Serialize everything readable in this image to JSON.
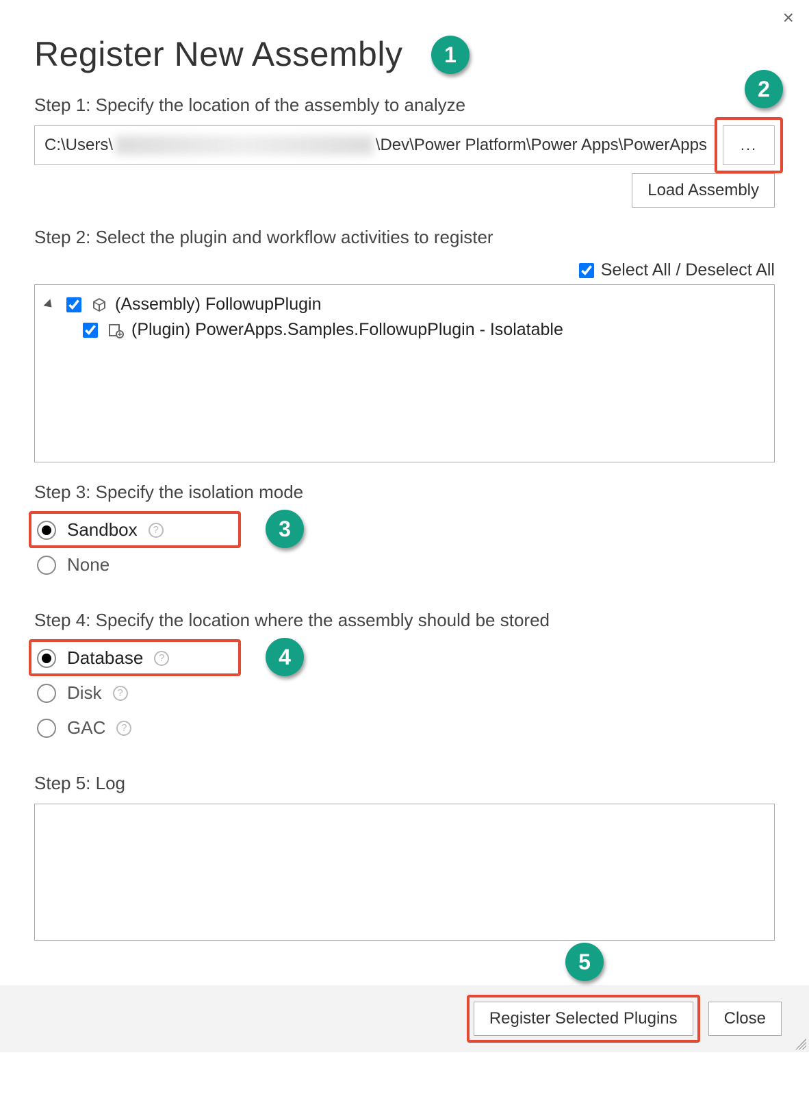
{
  "title": "Register New Assembly",
  "close_glyph": "×",
  "step1": {
    "label": "Step 1: Specify the location of the assembly to analyze",
    "path_prefix": "C:\\Users\\",
    "path_suffix": "\\Dev\\Power Platform\\Power Apps\\PowerApps",
    "browse_label": "...",
    "load_label": "Load Assembly"
  },
  "step2": {
    "label": "Step 2: Select the plugin and workflow activities to register",
    "select_all_label": "Select All / Deselect All",
    "select_all_checked": true,
    "tree": {
      "assembly": {
        "checked": true,
        "label": "(Assembly) FollowupPlugin"
      },
      "plugin": {
        "checked": true,
        "label": "(Plugin) PowerApps.Samples.FollowupPlugin - Isolatable"
      }
    }
  },
  "step3": {
    "label": "Step 3: Specify the isolation mode",
    "options": {
      "sandbox": "Sandbox",
      "none": "None"
    },
    "selected": "sandbox"
  },
  "step4": {
    "label": "Step 4: Specify the location where the assembly should be stored",
    "options": {
      "database": "Database",
      "disk": "Disk",
      "gac": "GAC"
    },
    "selected": "database"
  },
  "step5": {
    "label": "Step 5: Log",
    "value": ""
  },
  "footer": {
    "register_label": "Register Selected Plugins",
    "close_label": "Close"
  },
  "annotations": {
    "b1": "1",
    "b2": "2",
    "b3": "3",
    "b4": "4",
    "b5": "5"
  },
  "help_glyph": "?"
}
